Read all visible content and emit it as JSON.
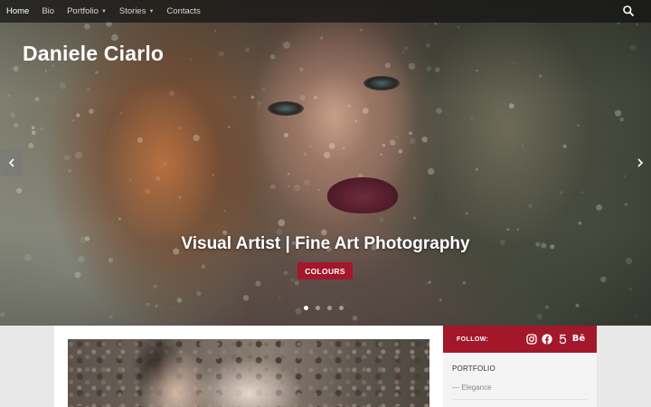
{
  "nav": {
    "items": [
      {
        "label": "Home",
        "active": true,
        "dropdown": false
      },
      {
        "label": "Bio",
        "active": false,
        "dropdown": false
      },
      {
        "label": "Portfolio",
        "active": false,
        "dropdown": true
      },
      {
        "label": "Stories",
        "active": false,
        "dropdown": true
      },
      {
        "label": "Contacts",
        "active": false,
        "dropdown": false
      }
    ],
    "search_icon": "search-icon"
  },
  "site": {
    "title": "Daniele Ciarlo"
  },
  "hero": {
    "caption": "Visual Artist | Fine Art Photography",
    "badge": "COLOURS",
    "slides_total": 4,
    "active_slide": 1,
    "prev_icon": "chevron-left-icon",
    "next_icon": "chevron-right-icon"
  },
  "sidebar": {
    "follow_label": "FOLLOW:",
    "social": [
      "instagram-icon",
      "facebook-icon",
      "500px-icon",
      "behance-icon"
    ],
    "behance_glyph": "Bē",
    "heading": "PORTFOLIO",
    "link": "— Elegance"
  },
  "colors": {
    "accent": "#a3172b",
    "nav_bg": "#141414",
    "sidebar_bg": "#f4f4f4"
  }
}
